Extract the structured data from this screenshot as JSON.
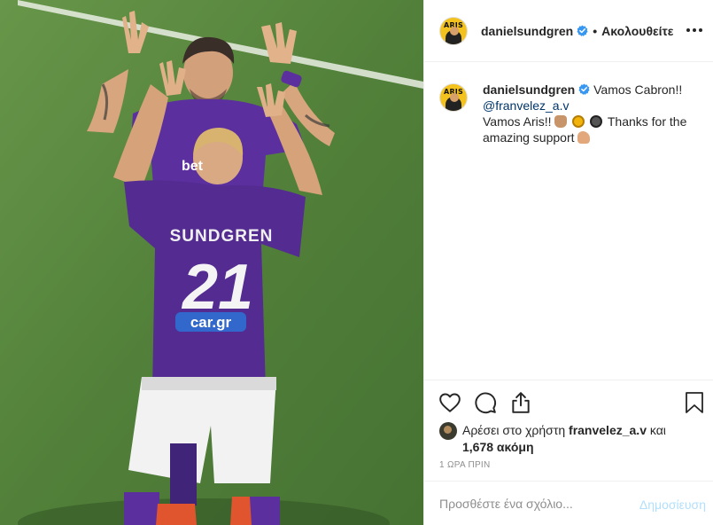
{
  "post": {
    "author": {
      "username": "danielsundgren",
      "verified": true,
      "avatar_text": "ARIS"
    },
    "follow_status": "Ακολουθείτε",
    "caption": {
      "username": "danielsundgren",
      "line1": "Vamos Cabron!!",
      "mention": "@franvelez_a.v",
      "line2": "Vamos Aris!!",
      "line3": "Thanks for the amazing support"
    },
    "photo": {
      "jersey_name": "SUNDGREN",
      "jersey_number": "21",
      "sponsor_back": "car.gr",
      "sponsor_front": "bet"
    },
    "likes": {
      "prefix": "Αρέσει στο χρήστη",
      "user": "franvelez_a.v",
      "conjunction": "και",
      "count": "1,678 ακόμη"
    },
    "timestamp": "1 ΩΡΑ ΠΡΙΝ",
    "comment": {
      "placeholder": "Προσθέστε ένα σχόλιο...",
      "post_label": "Δημοσίευση"
    },
    "icons": {
      "like": "heart-icon",
      "comment": "comment-icon",
      "share": "share-icon",
      "save": "bookmark-icon",
      "more": "more-icon"
    },
    "colors": {
      "jersey": "#5b2f9e",
      "verified": "#3897f0",
      "link": "#003569",
      "post_button_disabled": "#b2dffc"
    }
  }
}
